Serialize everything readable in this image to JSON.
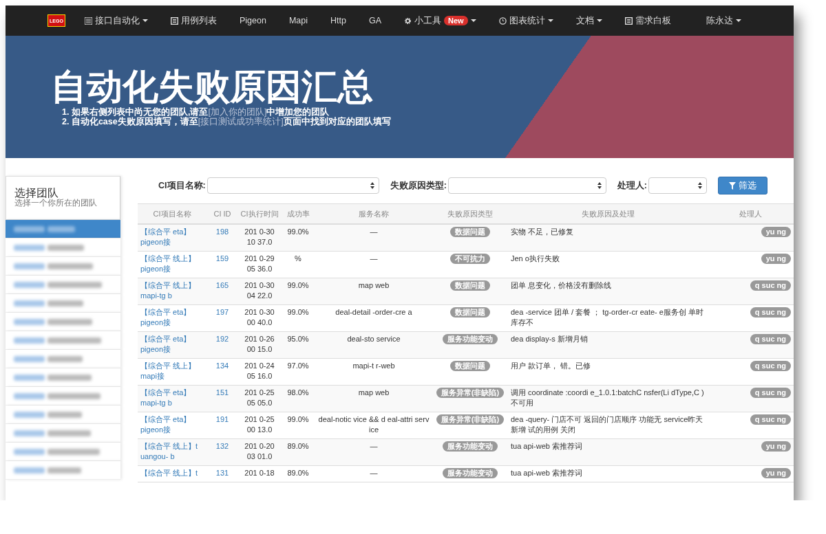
{
  "navbar": {
    "logo": "LEGO",
    "items": [
      {
        "label": "接口自动化",
        "kind": "list",
        "dropdown": true
      },
      {
        "label": "用例列表",
        "kind": "document",
        "dropdown": false
      },
      {
        "label": "Pigeon",
        "dropdown": false
      },
      {
        "label": "Mapi",
        "dropdown": false
      },
      {
        "label": "Http",
        "dropdown": false
      },
      {
        "label": "GA",
        "dropdown": false
      },
      {
        "label": "小工具",
        "kind": "settings",
        "badge": "New",
        "dropdown": true
      },
      {
        "label": "图表统计",
        "kind": "clock",
        "dropdown": true
      },
      {
        "label": "文档",
        "dropdown": true
      },
      {
        "label": "需求白板",
        "kind": "document",
        "dropdown": false
      }
    ],
    "user": "陈永达"
  },
  "banner": {
    "title": "自动化失败原因汇总",
    "notes": [
      {
        "number": "1.",
        "before": "如果右侧列表中尚无您的团队,请至",
        "link": "[加入你的团队]",
        "after": "中增加您的团队"
      },
      {
        "number": "2.",
        "before": "自动化case失败原因填写，请至",
        "link": "[接口测试成功率统计]",
        "after": "页面中找到对应的团队填写"
      }
    ]
  },
  "sidebar": {
    "title": "选择团队",
    "subtitle": "选择一个你所在的团队",
    "items": [
      {
        "selected": true
      },
      {
        "selected": false
      },
      {
        "selected": false
      },
      {
        "selected": false
      },
      {
        "selected": false
      },
      {
        "selected": false
      },
      {
        "selected": false
      },
      {
        "selected": false
      },
      {
        "selected": false
      },
      {
        "selected": false
      },
      {
        "selected": false
      },
      {
        "selected": false
      },
      {
        "selected": false
      },
      {
        "selected": false
      }
    ]
  },
  "filters": [
    {
      "label": "CI项目名称:"
    },
    {
      "label": "失败原因类型:"
    },
    {
      "label": "处理人:"
    }
  ],
  "filter_button": "筛选",
  "table": {
    "columns": [
      "CI项目名称",
      "CI ID",
      "CI执行时间",
      "成功率",
      "服务名称",
      "失败原因类型",
      "失败原因及处理",
      "处理人"
    ],
    "rows": [
      {
        "project": [
          "【综合平 eta】",
          "pigeon接"
        ],
        "id": "198",
        "time": [
          "201 0-30",
          "10 37.0"
        ],
        "rate": "99.0%",
        "service": "—",
        "type": "数据问题",
        "reason": "实物 不足，已修复",
        "owner": "yu ng"
      },
      {
        "project": [
          "【综合平 线上】",
          "pigeon接"
        ],
        "id": "159",
        "time": [
          "201 0-29",
          "05 36.0"
        ],
        "rate": "%",
        "service": "—",
        "type": "不可抗力",
        "reason": "Jen o执行失败",
        "owner": "yu ng"
      },
      {
        "project": [
          "【综合平 线上】",
          "mapi-tg b"
        ],
        "id": "165",
        "time": [
          "201 0-30",
          "04 22.0"
        ],
        "rate": "99.0%",
        "service": "map web",
        "type": "数据问题",
        "reason": "团单 息变化，价格没有删除线",
        "owner": "q suc ng"
      },
      {
        "project": [
          "【综合平 eta】",
          "pigeon接"
        ],
        "id": "197",
        "time": [
          "201 0-30",
          "00 40.0"
        ],
        "rate": "99.0%",
        "service": "deal-detail -order-cre a",
        "type": "数据问题",
        "reason": "dea -service 团单 / 套餐 ； tg-order-cr eate- e服务创 单时库存不",
        "owner": "q suc ng"
      },
      {
        "project": [
          "【综合平 eta】",
          "pigeon接"
        ],
        "id": "192",
        "time": [
          "201 0-26",
          "00 15.0"
        ],
        "rate": "95.0%",
        "service": "deal-sto service",
        "type": "服务功能变动",
        "reason": "dea display-s 新增月销",
        "owner": "q suc ng"
      },
      {
        "project": [
          "【综合平 线上】",
          "mapi接"
        ],
        "id": "134",
        "time": [
          "201 0-24",
          "05 16.0"
        ],
        "rate": "97.0%",
        "service": "mapi-t r-web",
        "type": "数据问题",
        "reason": "用户 款订单， 错。已修",
        "owner": "q suc ng"
      },
      {
        "project": [
          "【综合平 eta】",
          "mapi-tg b"
        ],
        "id": "151",
        "time": [
          "201 0-25",
          "05 05.0"
        ],
        "rate": "98.0%",
        "service": "map web",
        "type": "服务异常(非缺陷)",
        "reason": "调用 coordinate :coordi e_1.0.1:batchC nsfer(Li dType,C )不可用",
        "owner": "q suc ng"
      },
      {
        "project": [
          "【综合平 eta】",
          "pigeon接"
        ],
        "id": "191",
        "time": [
          "201 0-25",
          "00 13.0"
        ],
        "rate": "99.0%",
        "service": "deal-notic vice && d eal-attri service",
        "type": "服务异常(非缺陷)",
        "reason": "dea -query- 门店不可 返回的门店顺序 功能无 service昨天新增 试的用例 关闭",
        "owner": "q suc ng"
      },
      {
        "project": [
          "【综合平 线上】t",
          "uangou- b"
        ],
        "id": "132",
        "time": [
          "201 0-20",
          "03 01.0"
        ],
        "rate": "89.0%",
        "service": "—",
        "type": "服务功能变动",
        "reason": "tua api-web 索推荐词",
        "owner": "yu ng"
      },
      {
        "project": [
          "【综合平 线上】t"
        ],
        "id": "131",
        "time": [
          "201 0-18"
        ],
        "rate": "89.0%",
        "service": "—",
        "type": "服务功能变动",
        "reason": "tua api-web 索推荐词",
        "owner": "yu ng"
      }
    ]
  }
}
